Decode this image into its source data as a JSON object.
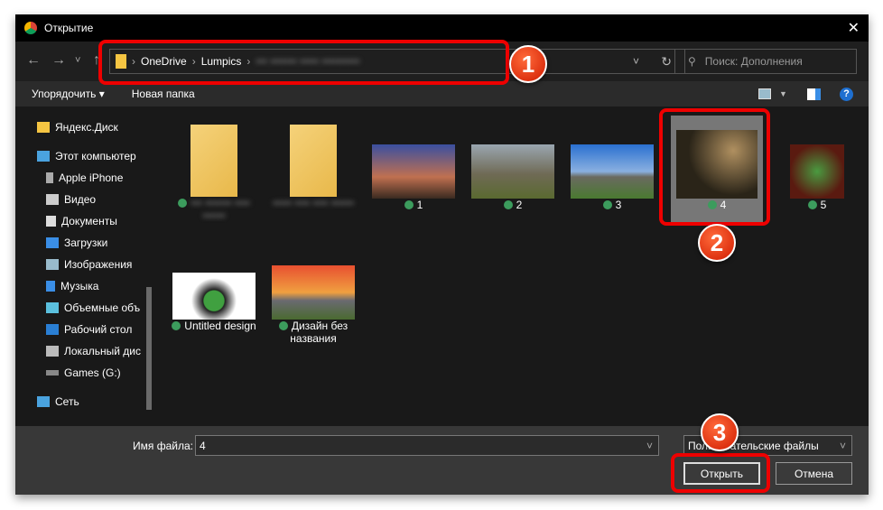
{
  "window": {
    "title": "Открытие",
    "close": "✕"
  },
  "nav": {
    "back": "←",
    "forward": "→",
    "recent": "˅",
    "up": "↑",
    "crumbs": [
      "OneDrive",
      "Lumpics"
    ],
    "blurred": "••• ••••••• ••••• ••••••••••",
    "refresh": "↻",
    "dropdown": "˅",
    "search_placeholder": "Поиск: Дополнения"
  },
  "toolbar": {
    "organize": "Упорядочить ▾",
    "new_folder": "Новая папка"
  },
  "sidebar": {
    "items": [
      {
        "label": "Яндекс.Диск"
      },
      {
        "label": "Этот компьютер"
      },
      {
        "label": "Apple iPhone"
      },
      {
        "label": "Видео"
      },
      {
        "label": "Документы"
      },
      {
        "label": "Загрузки"
      },
      {
        "label": "Изображения"
      },
      {
        "label": "Музыка"
      },
      {
        "label": "Объемные объ"
      },
      {
        "label": "Рабочий стол"
      },
      {
        "label": "Локальный дис"
      },
      {
        "label": "Games (G:)"
      },
      {
        "label": "Сеть"
      }
    ]
  },
  "files": [
    {
      "name": "••• ••••••• •••• ••••••",
      "kind": "folder"
    },
    {
      "name": "••••• •••• •••• ••••••",
      "kind": "folder"
    },
    {
      "name": "1"
    },
    {
      "name": "2"
    },
    {
      "name": "3"
    },
    {
      "name": "4",
      "selected": true
    },
    {
      "name": "5"
    },
    {
      "name": "Untitled design"
    },
    {
      "name": "Дизайн без названия"
    }
  ],
  "bottom": {
    "filename_label": "Имя файла:",
    "filename_value": "4",
    "filetype": "Пользовательские файлы",
    "open": "Открыть",
    "cancel": "Отмена"
  },
  "annotations": [
    "1",
    "2",
    "3"
  ],
  "colors": {
    "highlight": "#e00000"
  }
}
